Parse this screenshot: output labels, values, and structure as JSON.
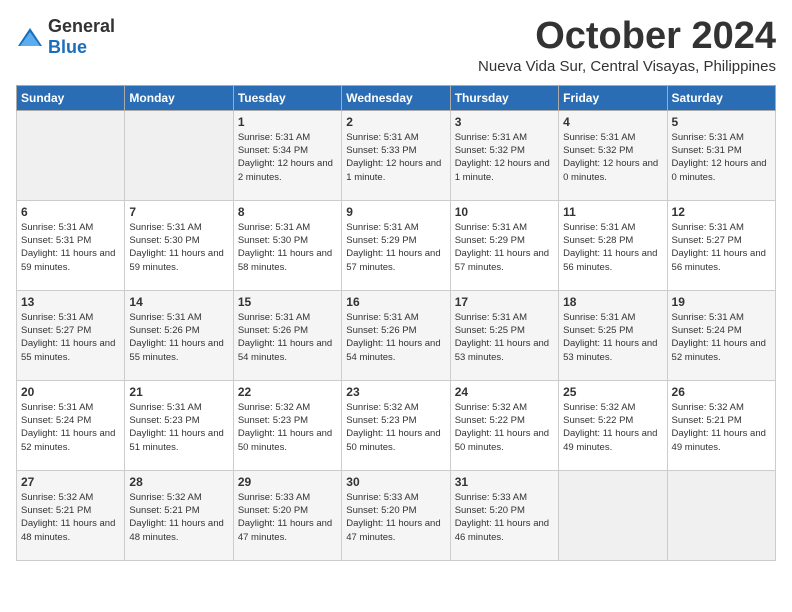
{
  "logo": {
    "general": "General",
    "blue": "Blue"
  },
  "title": "October 2024",
  "location": "Nueva Vida Sur, Central Visayas, Philippines",
  "weekdays": [
    "Sunday",
    "Monday",
    "Tuesday",
    "Wednesday",
    "Thursday",
    "Friday",
    "Saturday"
  ],
  "weeks": [
    [
      {
        "day": "",
        "sunrise": "",
        "sunset": "",
        "daylight": ""
      },
      {
        "day": "",
        "sunrise": "",
        "sunset": "",
        "daylight": ""
      },
      {
        "day": "1",
        "sunrise": "Sunrise: 5:31 AM",
        "sunset": "Sunset: 5:34 PM",
        "daylight": "Daylight: 12 hours and 2 minutes."
      },
      {
        "day": "2",
        "sunrise": "Sunrise: 5:31 AM",
        "sunset": "Sunset: 5:33 PM",
        "daylight": "Daylight: 12 hours and 1 minute."
      },
      {
        "day": "3",
        "sunrise": "Sunrise: 5:31 AM",
        "sunset": "Sunset: 5:32 PM",
        "daylight": "Daylight: 12 hours and 1 minute."
      },
      {
        "day": "4",
        "sunrise": "Sunrise: 5:31 AM",
        "sunset": "Sunset: 5:32 PM",
        "daylight": "Daylight: 12 hours and 0 minutes."
      },
      {
        "day": "5",
        "sunrise": "Sunrise: 5:31 AM",
        "sunset": "Sunset: 5:31 PM",
        "daylight": "Daylight: 12 hours and 0 minutes."
      }
    ],
    [
      {
        "day": "6",
        "sunrise": "Sunrise: 5:31 AM",
        "sunset": "Sunset: 5:31 PM",
        "daylight": "Daylight: 11 hours and 59 minutes."
      },
      {
        "day": "7",
        "sunrise": "Sunrise: 5:31 AM",
        "sunset": "Sunset: 5:30 PM",
        "daylight": "Daylight: 11 hours and 59 minutes."
      },
      {
        "day": "8",
        "sunrise": "Sunrise: 5:31 AM",
        "sunset": "Sunset: 5:30 PM",
        "daylight": "Daylight: 11 hours and 58 minutes."
      },
      {
        "day": "9",
        "sunrise": "Sunrise: 5:31 AM",
        "sunset": "Sunset: 5:29 PM",
        "daylight": "Daylight: 11 hours and 57 minutes."
      },
      {
        "day": "10",
        "sunrise": "Sunrise: 5:31 AM",
        "sunset": "Sunset: 5:29 PM",
        "daylight": "Daylight: 11 hours and 57 minutes."
      },
      {
        "day": "11",
        "sunrise": "Sunrise: 5:31 AM",
        "sunset": "Sunset: 5:28 PM",
        "daylight": "Daylight: 11 hours and 56 minutes."
      },
      {
        "day": "12",
        "sunrise": "Sunrise: 5:31 AM",
        "sunset": "Sunset: 5:27 PM",
        "daylight": "Daylight: 11 hours and 56 minutes."
      }
    ],
    [
      {
        "day": "13",
        "sunrise": "Sunrise: 5:31 AM",
        "sunset": "Sunset: 5:27 PM",
        "daylight": "Daylight: 11 hours and 55 minutes."
      },
      {
        "day": "14",
        "sunrise": "Sunrise: 5:31 AM",
        "sunset": "Sunset: 5:26 PM",
        "daylight": "Daylight: 11 hours and 55 minutes."
      },
      {
        "day": "15",
        "sunrise": "Sunrise: 5:31 AM",
        "sunset": "Sunset: 5:26 PM",
        "daylight": "Daylight: 11 hours and 54 minutes."
      },
      {
        "day": "16",
        "sunrise": "Sunrise: 5:31 AM",
        "sunset": "Sunset: 5:26 PM",
        "daylight": "Daylight: 11 hours and 54 minutes."
      },
      {
        "day": "17",
        "sunrise": "Sunrise: 5:31 AM",
        "sunset": "Sunset: 5:25 PM",
        "daylight": "Daylight: 11 hours and 53 minutes."
      },
      {
        "day": "18",
        "sunrise": "Sunrise: 5:31 AM",
        "sunset": "Sunset: 5:25 PM",
        "daylight": "Daylight: 11 hours and 53 minutes."
      },
      {
        "day": "19",
        "sunrise": "Sunrise: 5:31 AM",
        "sunset": "Sunset: 5:24 PM",
        "daylight": "Daylight: 11 hours and 52 minutes."
      }
    ],
    [
      {
        "day": "20",
        "sunrise": "Sunrise: 5:31 AM",
        "sunset": "Sunset: 5:24 PM",
        "daylight": "Daylight: 11 hours and 52 minutes."
      },
      {
        "day": "21",
        "sunrise": "Sunrise: 5:31 AM",
        "sunset": "Sunset: 5:23 PM",
        "daylight": "Daylight: 11 hours and 51 minutes."
      },
      {
        "day": "22",
        "sunrise": "Sunrise: 5:32 AM",
        "sunset": "Sunset: 5:23 PM",
        "daylight": "Daylight: 11 hours and 50 minutes."
      },
      {
        "day": "23",
        "sunrise": "Sunrise: 5:32 AM",
        "sunset": "Sunset: 5:23 PM",
        "daylight": "Daylight: 11 hours and 50 minutes."
      },
      {
        "day": "24",
        "sunrise": "Sunrise: 5:32 AM",
        "sunset": "Sunset: 5:22 PM",
        "daylight": "Daylight: 11 hours and 50 minutes."
      },
      {
        "day": "25",
        "sunrise": "Sunrise: 5:32 AM",
        "sunset": "Sunset: 5:22 PM",
        "daylight": "Daylight: 11 hours and 49 minutes."
      },
      {
        "day": "26",
        "sunrise": "Sunrise: 5:32 AM",
        "sunset": "Sunset: 5:21 PM",
        "daylight": "Daylight: 11 hours and 49 minutes."
      }
    ],
    [
      {
        "day": "27",
        "sunrise": "Sunrise: 5:32 AM",
        "sunset": "Sunset: 5:21 PM",
        "daylight": "Daylight: 11 hours and 48 minutes."
      },
      {
        "day": "28",
        "sunrise": "Sunrise: 5:32 AM",
        "sunset": "Sunset: 5:21 PM",
        "daylight": "Daylight: 11 hours and 48 minutes."
      },
      {
        "day": "29",
        "sunrise": "Sunrise: 5:33 AM",
        "sunset": "Sunset: 5:20 PM",
        "daylight": "Daylight: 11 hours and 47 minutes."
      },
      {
        "day": "30",
        "sunrise": "Sunrise: 5:33 AM",
        "sunset": "Sunset: 5:20 PM",
        "daylight": "Daylight: 11 hours and 47 minutes."
      },
      {
        "day": "31",
        "sunrise": "Sunrise: 5:33 AM",
        "sunset": "Sunset: 5:20 PM",
        "daylight": "Daylight: 11 hours and 46 minutes."
      },
      {
        "day": "",
        "sunrise": "",
        "sunset": "",
        "daylight": ""
      },
      {
        "day": "",
        "sunrise": "",
        "sunset": "",
        "daylight": ""
      }
    ]
  ]
}
